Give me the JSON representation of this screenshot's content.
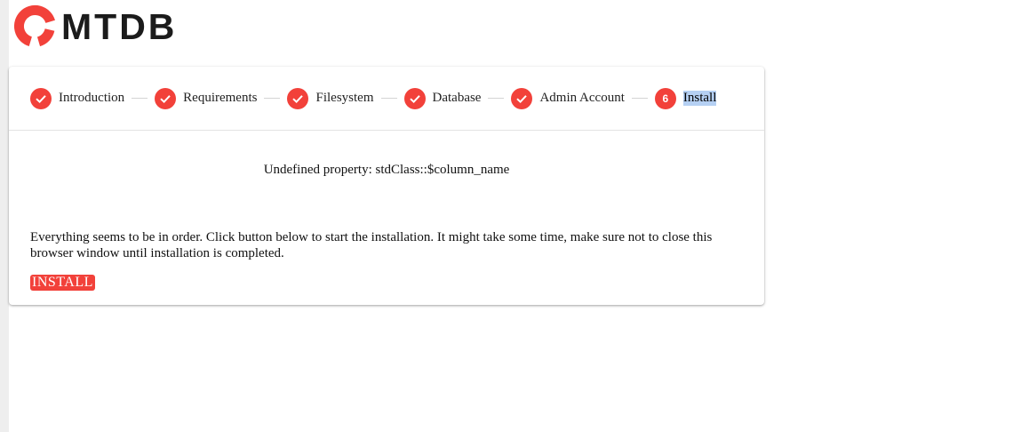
{
  "brand": {
    "logo_text": "MTDB",
    "logo_icon": "mtdb-ring-logo",
    "accent_color": "#f2413a"
  },
  "steps": [
    {
      "label": "Introduction",
      "state": "complete",
      "icon": "check-icon"
    },
    {
      "label": "Requirements",
      "state": "complete",
      "icon": "check-icon"
    },
    {
      "label": "Filesystem",
      "state": "complete",
      "icon": "check-icon"
    },
    {
      "label": "Database",
      "state": "complete",
      "icon": "check-icon"
    },
    {
      "label": "Admin Account",
      "state": "complete",
      "icon": "check-icon"
    },
    {
      "label": "Install",
      "state": "active",
      "number": "6"
    }
  ],
  "main": {
    "error_message": "Undefined property: stdClass::$column_name",
    "info_message": "Everything seems to be in order. Click button below to start the installation. It might take some time, make sure not to close this browser window until installation is completed.",
    "install_label": "INSTALL"
  }
}
